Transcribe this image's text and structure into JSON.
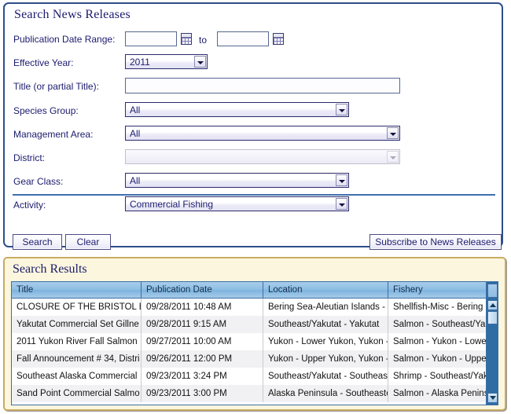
{
  "search_panel": {
    "title": "Search News Releases",
    "fields": {
      "publication_date_range": {
        "label": "Publication Date Range:",
        "from_value": "",
        "to_text": "to",
        "to_value": "",
        "calendar_icon": "calendar-icon"
      },
      "effective_year": {
        "label": "Effective Year:",
        "value": "2011"
      },
      "title": {
        "label": "Title (or partial Title):",
        "value": ""
      },
      "species_group": {
        "label": "Species Group:",
        "value": "All"
      },
      "management_area": {
        "label": "Management Area:",
        "value": "All"
      },
      "district": {
        "label": "District:",
        "value": ""
      },
      "gear_class": {
        "label": "Gear Class:",
        "value": "All"
      },
      "activity": {
        "label": "Activity:",
        "value": "Commercial Fishing"
      }
    },
    "buttons": {
      "search": "Search",
      "clear": "Clear",
      "subscribe": "Subscribe to News Releases"
    }
  },
  "results_panel": {
    "title": "Search Results",
    "columns": [
      "Title",
      "Publication Date",
      "Location",
      "Fishery"
    ],
    "rows": [
      {
        "title": "CLOSURE OF THE BRISTOL E",
        "date": "09/28/2011 10:48 AM",
        "location": "Bering Sea-Aleutian Islands - E",
        "fishery": "Shellfish-Misc - Bering Sea-Aleu"
      },
      {
        "title": "Yakutat Commercial Set Gillne",
        "date": "09/28/2011 9:15 AM",
        "location": "Southeast/Yakutat - Yakutat",
        "fishery": "Salmon - Southeast/Yakutat - Ya"
      },
      {
        "title": "2011 Yukon River Fall Salmon",
        "date": "09/27/2011 10:00 AM",
        "location": "Yukon - Lower Yukon, Yukon - I",
        "fishery": "Salmon - Yukon - Lower Yukon -"
      },
      {
        "title": "Fall Announcement # 34, Distri",
        "date": "09/26/2011 12:00 PM",
        "location": "Yukon - Upper Yukon, Yukon - \u0001",
        "fishery": "Salmon - Yukon - Upper Yukon -"
      },
      {
        "title": "Southeast Alaska Commercial",
        "date": "09/23/2011 3:24 PM",
        "location": "Southeast/Yakutat - Southeast",
        "fishery": "Shrimp - Southeast/Yakutat - Sc"
      },
      {
        "title": "Sand Point Commercial Salmo",
        "date": "09/23/2011 3:00 PM",
        "location": "Alaska Peninsula - Southeaste",
        "fishery": "Salmon - Alaska Peninsula - Sc"
      }
    ],
    "scrollbar": {
      "up_icon": "scroll-up-arrow-icon",
      "down_icon": "scroll-down-arrow-icon"
    }
  },
  "colors": {
    "panel_border": "#2d4e8a",
    "results_border": "#c8ab63",
    "results_bg": "#fbf6dd",
    "header_blue": "#8dbde3",
    "text_navy": "#1b1b6e"
  }
}
